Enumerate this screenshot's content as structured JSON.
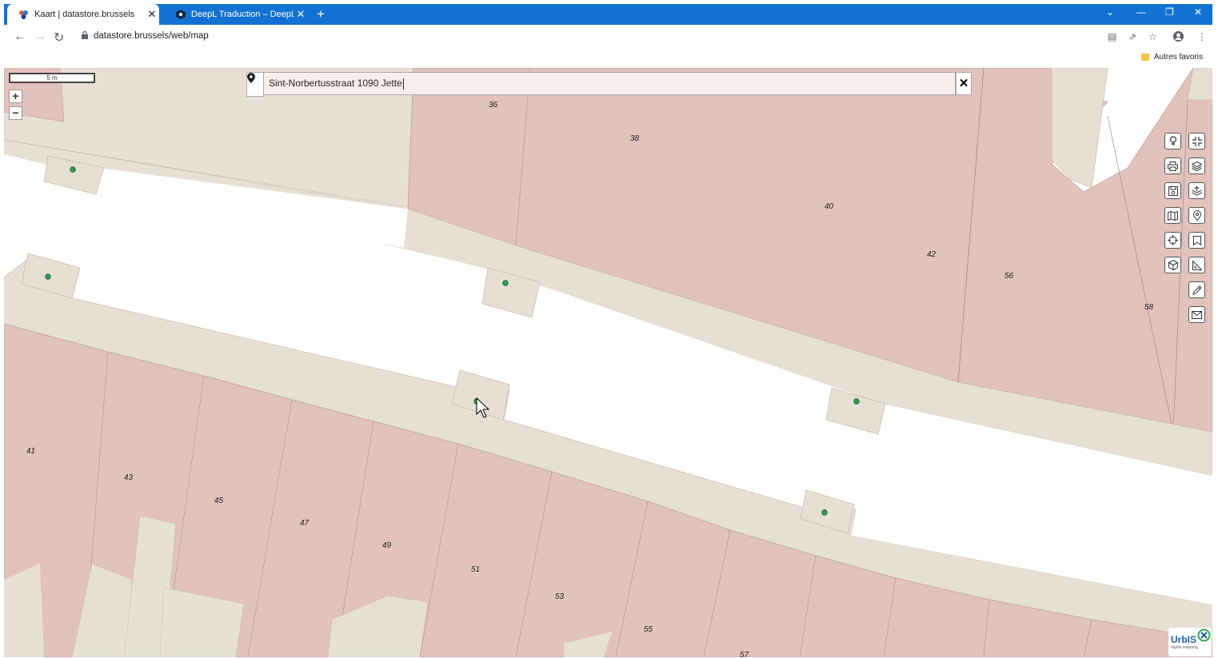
{
  "browser": {
    "tabs": [
      {
        "title": "Kaart | datastore.brussels",
        "active": true
      },
      {
        "title": "DeepL Traduction – DeepL Transl",
        "active": false
      }
    ],
    "url": "datastore.brussels/web/map",
    "bookmark_folder": "Autres favoris",
    "accent_color": "#1172d3"
  },
  "map": {
    "scale_label": "5 m",
    "search_value": "Sint-Norbertusstraat  1090 Jette",
    "house_numbers": [
      "36",
      "38",
      "40",
      "42",
      "56",
      "58",
      "41",
      "43",
      "45",
      "47",
      "49",
      "51",
      "53",
      "55",
      "57"
    ],
    "colors": {
      "parcel": "#e2c2bc",
      "sidewalk": "#e6e0d4",
      "road": "#ffffff",
      "marker": "#2e9e4e"
    }
  },
  "tools": [
    "info-icon",
    "fullscreen-icon",
    "print-icon",
    "layers-icon",
    "save-icon",
    "layer-settings-icon",
    "map-icon",
    "location-pin-icon",
    "crosshair-icon",
    "bookmark-icon",
    "3d-cube-icon",
    "measure-icon",
    "draw-icon",
    "mail-icon"
  ],
  "logo": {
    "name": "UrbIS",
    "subtitle": "digital mapping"
  }
}
